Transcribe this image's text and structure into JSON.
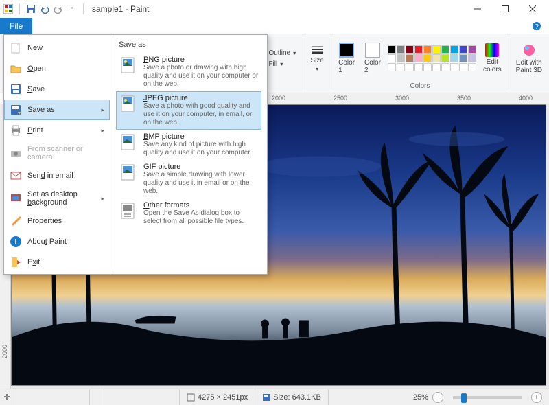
{
  "titlebar": {
    "title": "sample1 - Paint"
  },
  "tabs": {
    "file": "File"
  },
  "ribbon": {
    "outline": "Outline",
    "fill": "Fill",
    "size": "Size",
    "color1": "Color\n1",
    "color2": "Color\n2",
    "colors_group": "Colors",
    "edit_colors": "Edit\ncolors",
    "paint3d": "Edit with\nPaint 3D"
  },
  "palette": [
    "#000000",
    "#7f7f7f",
    "#880015",
    "#ed1c24",
    "#ff7f27",
    "#fff200",
    "#22b14c",
    "#00a2e8",
    "#3f48cc",
    "#a349a4",
    "#ffffff",
    "#c3c3c3",
    "#b97a57",
    "#ffaec9",
    "#ffc90e",
    "#efe4b0",
    "#b5e61d",
    "#99d9ea",
    "#7092be",
    "#c8bfe7",
    "#ffffff",
    "#ffffff",
    "#ffffff",
    "#ffffff",
    "#ffffff",
    "#ffffff",
    "#ffffff",
    "#ffffff",
    "#ffffff",
    "#ffffff"
  ],
  "ruler_h": [
    "2000",
    "2500",
    "3000",
    "3500",
    "4000"
  ],
  "ruler_v": [
    "2000"
  ],
  "file_menu": {
    "items": [
      {
        "label": "New",
        "key": "N"
      },
      {
        "label": "Open",
        "key": "O"
      },
      {
        "label": "Save",
        "key": "S"
      },
      {
        "label": "Save as",
        "key": "a",
        "arrow": true,
        "selected": true
      },
      {
        "label": "Print",
        "key": "P",
        "arrow": true
      },
      {
        "label": "From scanner or camera",
        "key": "",
        "disabled": true
      },
      {
        "label": "Send in email",
        "key": "d"
      },
      {
        "label": "Set as desktop background",
        "key": "b",
        "arrow": true
      },
      {
        "label": "Properties",
        "key": "e"
      },
      {
        "label": "About Paint",
        "key": "t"
      },
      {
        "label": "Exit",
        "key": "x"
      }
    ],
    "submenu_header": "Save as",
    "submenu": [
      {
        "title": "PNG picture",
        "key": "P",
        "desc": "Save a photo or drawing with high quality and use it on your computer or on the web."
      },
      {
        "title": "JPEG picture",
        "key": "J",
        "desc": "Save a photo with good quality and use it on your computer, in email, or on the web.",
        "selected": true
      },
      {
        "title": "BMP picture",
        "key": "B",
        "desc": "Save any kind of picture with high quality and use it on your computer."
      },
      {
        "title": "GIF picture",
        "key": "G",
        "desc": "Save a simple drawing with lower quality and use it in email or on the web."
      },
      {
        "title": "Other formats",
        "key": "O",
        "desc": "Open the Save As dialog box to select from all possible file types."
      }
    ]
  },
  "status": {
    "dimensions": "4275 × 2451px",
    "size": "Size: 643.1KB",
    "zoom": "25%"
  }
}
